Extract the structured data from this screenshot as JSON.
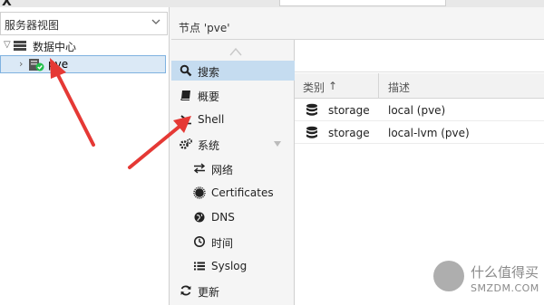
{
  "top_bar": {
    "logo_fragment": "X"
  },
  "tree": {
    "view_selector": "服务器视图",
    "root_label": "数据中心",
    "node_label": "pve"
  },
  "header": {
    "title": "节点 'pve'"
  },
  "menu": {
    "items": [
      {
        "label": "搜索",
        "icon": "search-icon",
        "active": true
      },
      {
        "label": "概要",
        "icon": "book-icon"
      },
      {
        "label": "Shell",
        "icon": "terminal-icon"
      },
      {
        "label": "系统",
        "icon": "gears-icon",
        "expandable": true
      },
      {
        "label": "网络",
        "icon": "exchange-icon"
      },
      {
        "label": "Certificates",
        "icon": "certificate-icon"
      },
      {
        "label": "DNS",
        "icon": "globe-icon"
      },
      {
        "label": "时间",
        "icon": "clock-icon"
      },
      {
        "label": "Syslog",
        "icon": "list-icon"
      },
      {
        "label": "更新",
        "icon": "refresh-icon"
      }
    ]
  },
  "grid": {
    "columns": [
      "类别",
      "描述"
    ],
    "sort_indicator": "↑",
    "rows": [
      {
        "type": "storage",
        "description": "local (pve)"
      },
      {
        "type": "storage",
        "description": "local-lvm (pve)"
      }
    ]
  },
  "watermark": {
    "line1": "什么值得买",
    "line2": "SMZDM.COM"
  },
  "colors": {
    "selection": "#dbe9f6",
    "active_menu": "#c5dcf0",
    "arrow": "#e53935",
    "status_ok": "#21bf4b"
  }
}
